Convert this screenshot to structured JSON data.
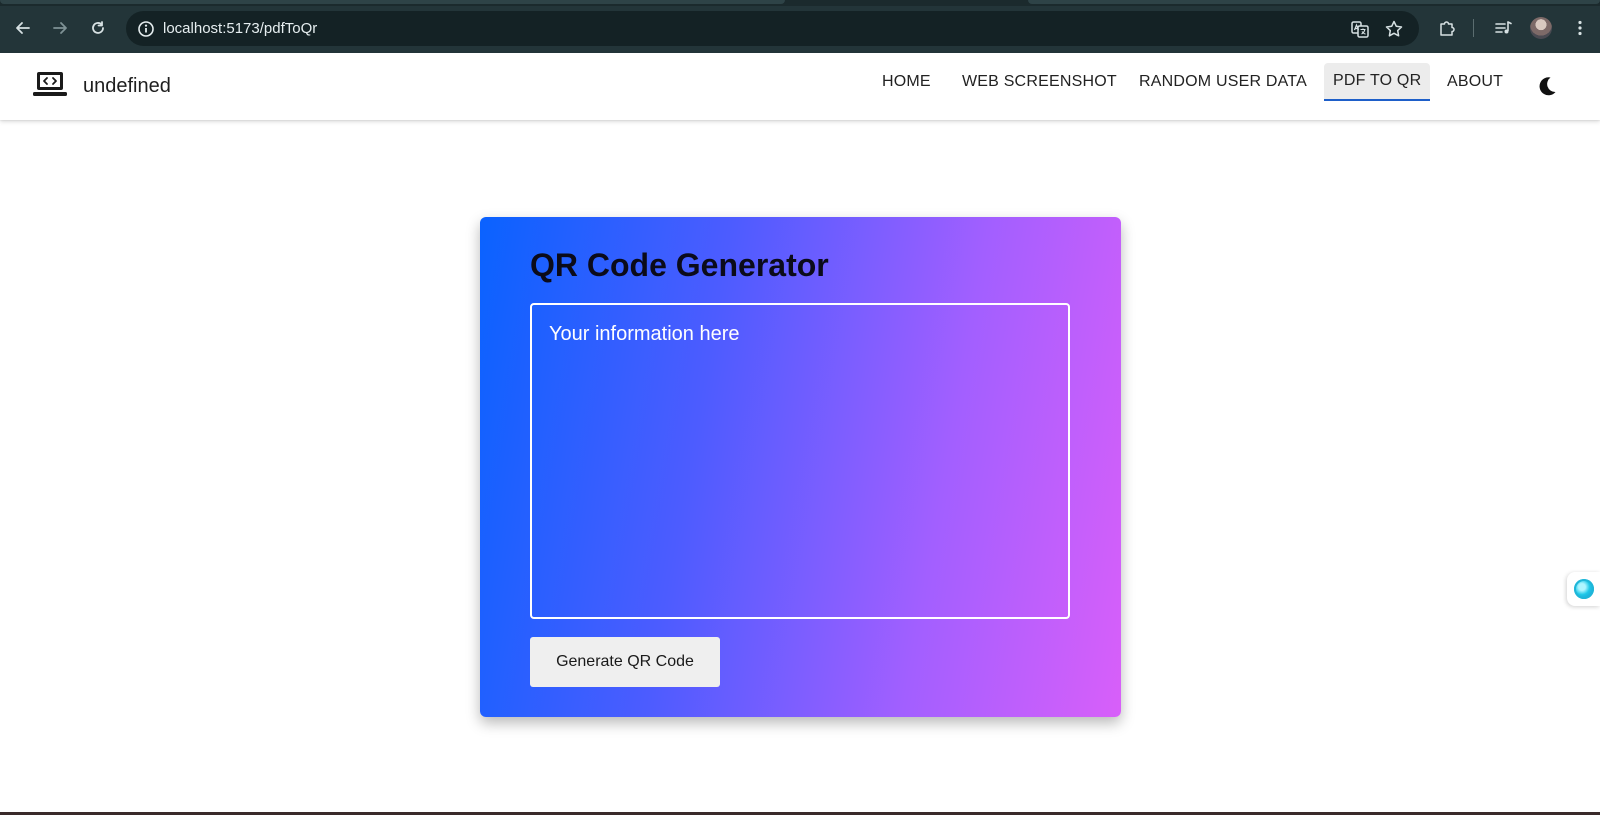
{
  "browser": {
    "url": "localhost:5173/pdfToQr"
  },
  "header": {
    "brand_name": "undefined",
    "nav": [
      {
        "label": "HOME"
      },
      {
        "label": "WEB SCREENSHOT"
      },
      {
        "label": "RANDOM USER DATA"
      },
      {
        "label": "PDF TO QR"
      },
      {
        "label": "ABOUT"
      }
    ],
    "active_nav": "PDF TO QR",
    "accent_color": "#1e5fc9"
  },
  "main": {
    "title": "QR Code Generator",
    "input_placeholder": "Your information here",
    "input_value": "",
    "generate_button_label": "Generate QR Code",
    "gradient_colors": [
      "#0a62ff",
      "#d85ff9"
    ]
  },
  "icons": {
    "back": "arrow-left-icon",
    "forward": "arrow-right-icon",
    "reload": "reload-icon",
    "site_info": "info-icon",
    "translate": "translate-icon",
    "bookmark": "star-icon",
    "extensions": "puzzle-icon",
    "media": "media-queue-icon",
    "menu": "more-vert-icon",
    "brand": "laptop-code-icon",
    "theme": "moon-icon",
    "widget": "assistant-orb-icon"
  }
}
